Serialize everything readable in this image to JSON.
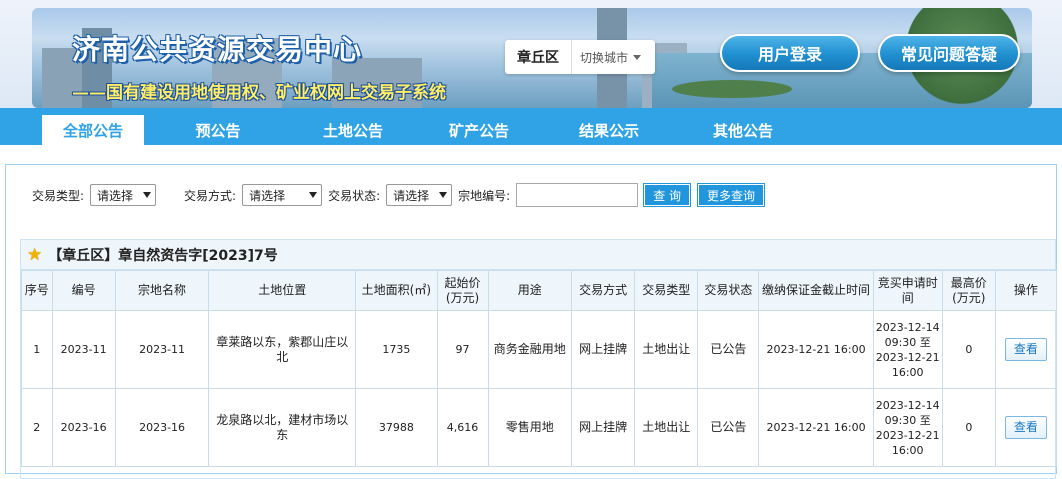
{
  "header": {
    "title": "济南公共资源交易中心",
    "subtitle": "——国有建设用地使用权、矿业权网上交易子系统",
    "city": "章丘区",
    "switch_city": "切换城市",
    "login": "用户登录",
    "faq": "常见问题答疑"
  },
  "nav": {
    "items": [
      "全部公告",
      "预公告",
      "土地公告",
      "矿产公告",
      "结果公示",
      "其他公告"
    ],
    "active_index": 0
  },
  "filters": {
    "type_label": "交易类型:",
    "type_value": "请选择",
    "mode_label": "交易方式:",
    "mode_value": "请选择",
    "status_label": "交易状态:",
    "status_value": "请选择",
    "parcel_label": "宗地编号:",
    "parcel_value": "",
    "query": "查 询",
    "more_query": "更多查询"
  },
  "announcement": {
    "title": "【章丘区】章自然资告字[2023]7号"
  },
  "table": {
    "headers": [
      "序号",
      "编号",
      "宗地名称",
      "土地位置",
      "土地面积(㎡)",
      "起始价(万元)",
      "用途",
      "交易方式",
      "交易类型",
      "交易状态",
      "缴纳保证金截止时间",
      "竞买申请时间",
      "最高价(万元)",
      "操作"
    ],
    "rows": [
      {
        "no": "1",
        "code": "2023-11",
        "name": "2023-11",
        "location": "章莱路以东，紫郡山庄以北",
        "area": "1735",
        "price": "97",
        "use": "商务金融用地",
        "mode": "网上挂牌",
        "type": "土地出让",
        "status": "已公告",
        "deposit_deadline": "2023-12-21 16:00",
        "apply_time": "2023-12-14 09:30 至 2023-12-21 16:00",
        "max_price": "0",
        "action": "查看"
      },
      {
        "no": "2",
        "code": "2023-16",
        "name": "2023-16",
        "location": "龙泉路以北，建材市场以东",
        "area": "37988",
        "price": "4,616",
        "use": "零售用地",
        "mode": "网上挂牌",
        "type": "土地出让",
        "status": "已公告",
        "deposit_deadline": "2023-12-21 16:00",
        "apply_time": "2023-12-14 09:30 至 2023-12-21 16:00",
        "max_price": "0",
        "action": "查看"
      }
    ]
  }
}
